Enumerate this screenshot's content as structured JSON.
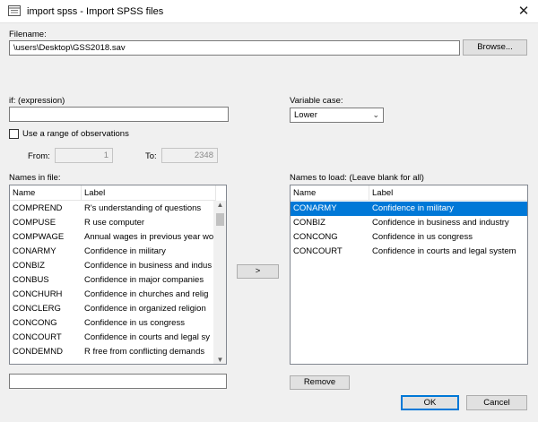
{
  "window": {
    "title": "import spss - Import SPSS files",
    "close_glyph": "✕"
  },
  "filename": {
    "label": "Filename:",
    "value": "\\users\\Desktop\\GSS2018.sav",
    "browse_label": "Browse..."
  },
  "if_expr": {
    "label": "if: (expression)",
    "value": ""
  },
  "variable_case": {
    "label": "Variable case:",
    "selected": "Lower"
  },
  "range": {
    "checkbox_label": "Use a range of observations",
    "checked": false,
    "from_label": "From:",
    "from_value": "1",
    "to_label": "To:",
    "to_value": "2348"
  },
  "names_in_file": {
    "label": "Names in file:",
    "col_name": "Name",
    "col_label": "Label",
    "rows": [
      {
        "name": "COMPREND",
        "label": "R's understanding of questions"
      },
      {
        "name": "COMPUSE",
        "label": "R use computer"
      },
      {
        "name": "COMPWAGE",
        "label": "Annual wages in previous year wo"
      },
      {
        "name": "CONARMY",
        "label": "Confidence in military"
      },
      {
        "name": "CONBIZ",
        "label": "Confidence in business and indus"
      },
      {
        "name": "CONBUS",
        "label": "Confidence in major companies"
      },
      {
        "name": "CONCHURH",
        "label": "Confidence in churches and relig"
      },
      {
        "name": "CONCLERG",
        "label": "Confidence in organized religion"
      },
      {
        "name": "CONCONG",
        "label": "Confidence in us congress"
      },
      {
        "name": "CONCOURT",
        "label": "Confidence in courts and legal sy"
      },
      {
        "name": "CONDEMND",
        "label": "R free from conflicting demands"
      }
    ],
    "filter_value": ""
  },
  "move_button": {
    "label": ">"
  },
  "names_to_load": {
    "label": "Names to load: (Leave blank for all)",
    "col_name": "Name",
    "col_label": "Label",
    "rows": [
      {
        "name": "CONARMY",
        "label": "Confidence in military",
        "selected": true
      },
      {
        "name": "CONBIZ",
        "label": "Confidence in business and industry",
        "selected": false
      },
      {
        "name": "CONCONG",
        "label": "Confidence in us congress",
        "selected": false
      },
      {
        "name": "CONCOURT",
        "label": "Confidence in courts and legal system",
        "selected": false
      }
    ]
  },
  "remove_label": "Remove",
  "ok_label": "OK",
  "cancel_label": "Cancel",
  "colors": {
    "selection": "#0078d7",
    "dialog_bg": "#f0f0f0"
  }
}
